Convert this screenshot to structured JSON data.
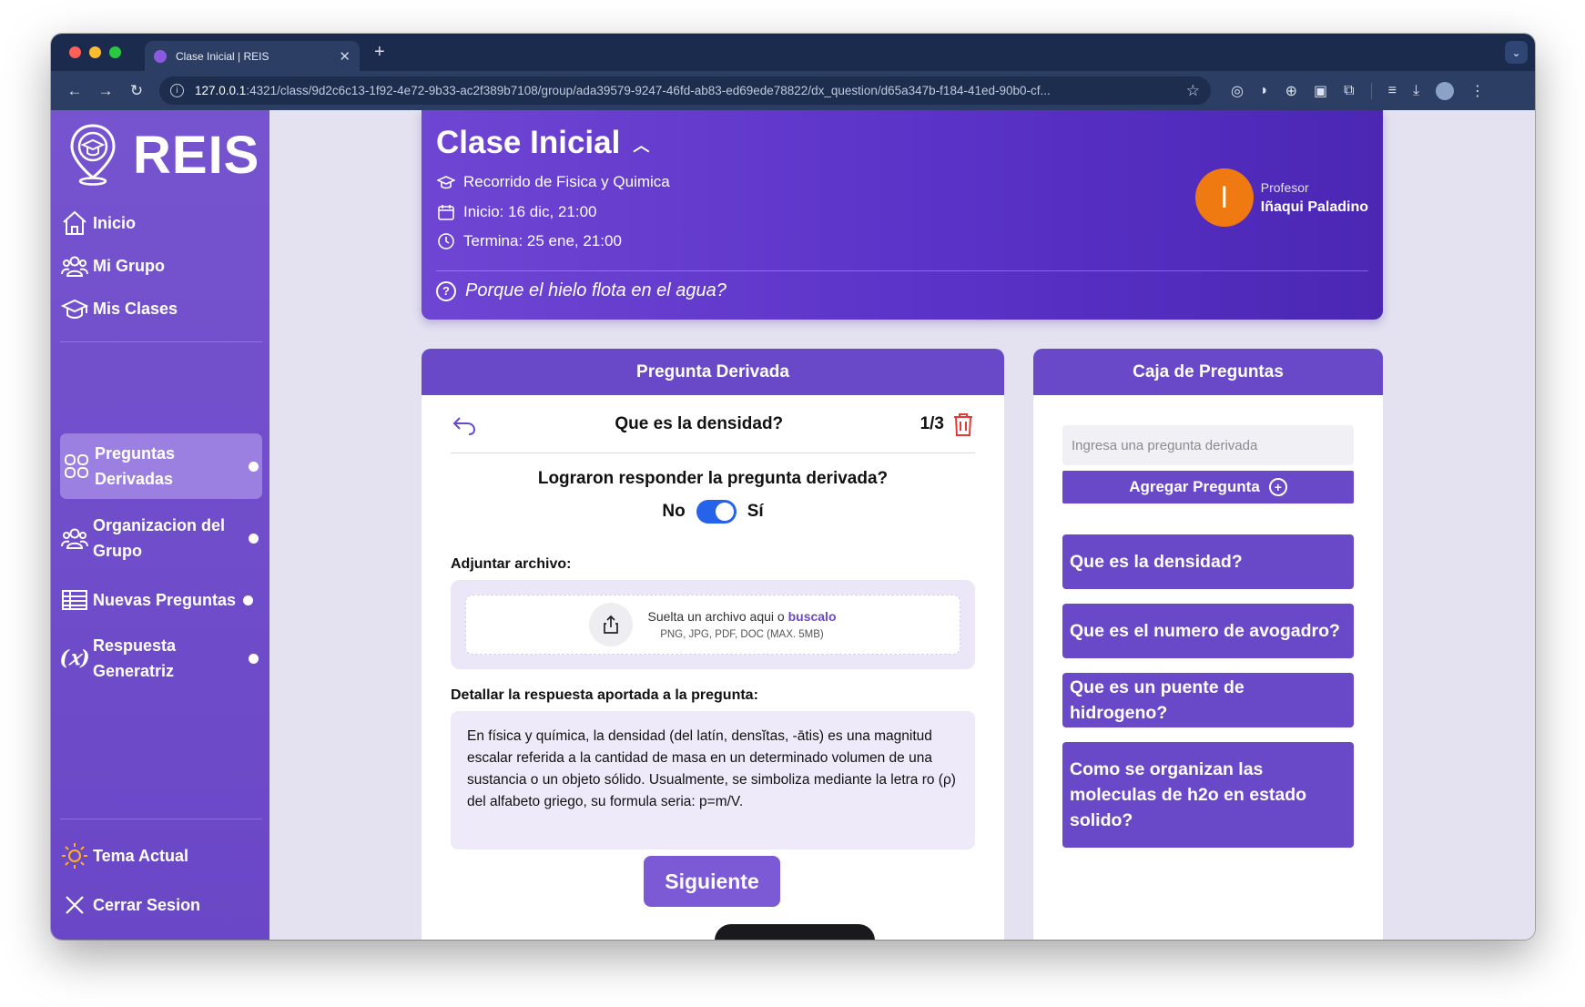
{
  "browser": {
    "tab_title": "Clase Inicial | REIS",
    "url_host": "127.0.0.1",
    "url_rest": ":4321/class/9d2c6c13-1f92-4e72-9b33-ac2f389b7108/group/ada39579-9247-46fd-ab83-ed69ede78822/dx_question/d65a347b-f184-41ed-90b0-cf..."
  },
  "sidebar": {
    "brand": "REIS",
    "nav": [
      {
        "label": "Inicio",
        "icon": "home-icon"
      },
      {
        "label": "Mi Grupo",
        "icon": "group-icon"
      },
      {
        "label": "Mis Clases",
        "icon": "graduation-cap-icon"
      }
    ],
    "sections": [
      {
        "label": "Preguntas Derivadas",
        "icon": "grid-icon",
        "active": true
      },
      {
        "label": "Organizacion del Grupo",
        "icon": "group-icon",
        "active": false
      },
      {
        "label": "Nuevas Preguntas",
        "icon": "table-icon",
        "active": false
      },
      {
        "label": "Respuesta Generatriz",
        "icon": "function-icon",
        "active": false
      }
    ],
    "footer": [
      {
        "label": "Tema Actual",
        "icon": "sun-icon"
      },
      {
        "label": "Cerrar Sesion",
        "icon": "close-icon"
      }
    ]
  },
  "header": {
    "title": "Clase Inicial",
    "course": "Recorrido de Fisica y Quimica",
    "start": "Inicio: 16 dic, 21:00",
    "end": "Termina: 25 ene, 21:00",
    "question": "Porque el hielo flota en el agua?",
    "professor_role": "Profesor",
    "professor_name": "Iñaqui Paladino",
    "professor_initial": "I"
  },
  "derived": {
    "card_title": "Pregunta Derivada",
    "question": "Que es la densidad?",
    "counter": "1/3",
    "answered_prompt": "Lograron responder la pregunta derivada?",
    "toggle_no": "No",
    "toggle_yes": "Sí",
    "toggle_on": true,
    "attach_label": "Adjuntar archivo:",
    "drop_text": "Suelta un archivo aqui o ",
    "drop_link": "buscalo",
    "drop_formats": "PNG, JPG, PDF, DOC (MAX. 5MB)",
    "detail_label": "Detallar la respuesta aportada a la pregunta:",
    "answer": "En física y química, la densidad (del latín, densĭtas, -ātis) es una magnitud escalar referida a la cantidad de masa en un determinado volumen de una sustancia o un objeto sólido. Usualmente, se simboliza mediante la letra ro (ρ) del alfabeto griego, su formula seria: p=m/V.",
    "next_label": "Siguiente"
  },
  "question_box": {
    "card_title": "Caja de Preguntas",
    "input_placeholder": "Ingresa una pregunta derivada",
    "add_label": "Agregar Pregunta",
    "items": [
      "Que es la densidad?",
      "Que es el numero de avogadro?",
      "Que es un puente de hidrogeno?",
      "Como se organizan las moleculas de h2o en estado solido?"
    ]
  },
  "colors": {
    "sidebar": "#7654cf",
    "accent": "#6a49c8",
    "header_start": "#6f45d3",
    "header_end": "#4b27b4",
    "avatar": "#f07a12",
    "toggle": "#2563eb"
  }
}
